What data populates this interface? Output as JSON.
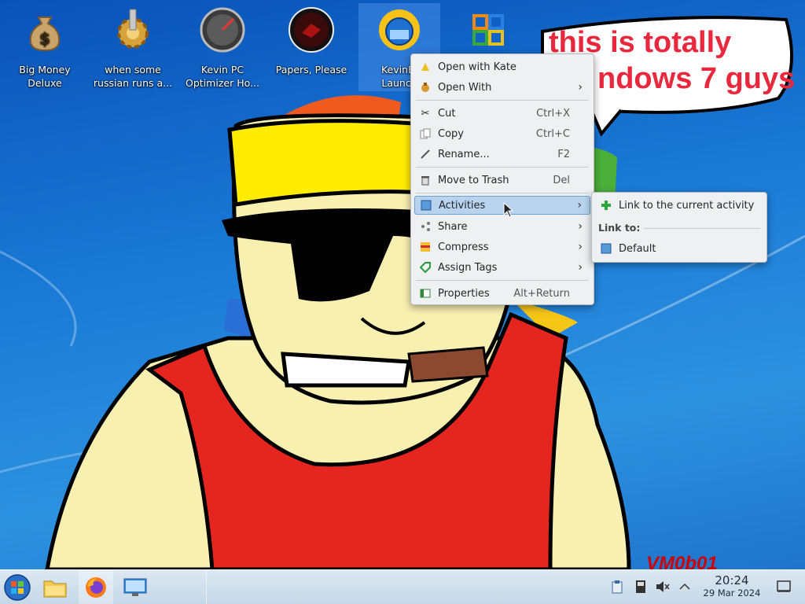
{
  "desktop": {
    "icons": [
      {
        "name": "big-money-deluxe",
        "label_line1": "Big Money",
        "label_line2": "Deluxe",
        "icon": "money-bag-icon"
      },
      {
        "name": "russian-runs",
        "label_line1": "when some",
        "label_line2": "russian runs a...",
        "icon": "cog-icon"
      },
      {
        "name": "kevin-pc-optimizer",
        "label_line1": "Kevin PC",
        "label_line2": "Optimizer Ho...",
        "icon": "gauge-icon"
      },
      {
        "name": "papers-please",
        "label_line1": "Papers, Please",
        "label_line2": "",
        "icon": "papers-please-icon"
      },
      {
        "name": "kevinbl-launcher",
        "label_line1": "KevinBl",
        "label_line2": "Launch",
        "icon": "launcher-globe-icon",
        "selected": true
      },
      {
        "name": "office-app",
        "label_line1": "",
        "label_line2": "",
        "icon": "office-icon"
      }
    ],
    "bubble_line1": "this is totally",
    "bubble_line2": "ndows 7 guys",
    "watermark": "VM0b01"
  },
  "context_menu": {
    "items": [
      {
        "label": "Open with Kate",
        "shortcut": "",
        "submenu": false,
        "icon": "kate-icon"
      },
      {
        "label": "Open With",
        "shortcut": "",
        "submenu": true,
        "icon": "open-with-icon"
      },
      {
        "label": "Cut",
        "shortcut": "Ctrl+X",
        "submenu": false,
        "icon": "scissors-icon"
      },
      {
        "label": "Copy",
        "shortcut": "Ctrl+C",
        "submenu": false,
        "icon": "copy-icon"
      },
      {
        "label": "Rename...",
        "shortcut": "F2",
        "submenu": false,
        "icon": "rename-icon"
      },
      {
        "label": "Move to Trash",
        "shortcut": "Del",
        "submenu": false,
        "icon": "trash-icon"
      },
      {
        "label": "Activities",
        "shortcut": "",
        "submenu": true,
        "icon": "activities-icon",
        "highlighted": true
      },
      {
        "label": "Share",
        "shortcut": "",
        "submenu": true,
        "icon": "share-icon"
      },
      {
        "label": "Compress",
        "shortcut": "",
        "submenu": true,
        "icon": "compress-icon"
      },
      {
        "label": "Assign Tags",
        "shortcut": "",
        "submenu": true,
        "icon": "tag-icon"
      },
      {
        "label": "Properties",
        "shortcut": "Alt+Return",
        "submenu": false,
        "icon": "properties-icon"
      }
    ]
  },
  "activities_submenu": {
    "link_current": "Link to the current activity",
    "link_to_header": "Link to:",
    "default_label": "Default"
  },
  "taskbar": {
    "time": "20:24",
    "date": "29 Mar 2024",
    "apps": [
      "start-orb-icon",
      "file-manager-icon",
      "firefox-icon",
      "system-settings-icon"
    ]
  },
  "colors": {
    "highlight": "#b8d3ee",
    "bubble_text": "#e8283c",
    "desktop_blue": "#1a7ad6"
  }
}
